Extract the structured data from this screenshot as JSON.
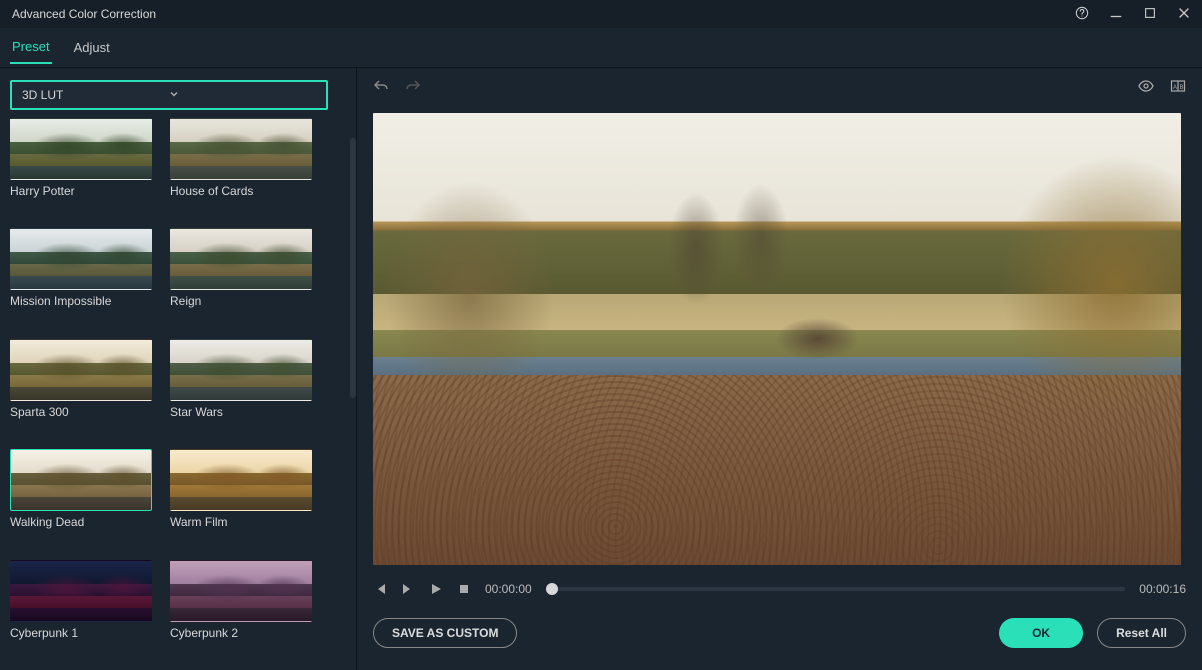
{
  "window": {
    "title": "Advanced Color Correction"
  },
  "tabs": {
    "preset": "Preset",
    "adjust": "Adjust",
    "active": "preset"
  },
  "dropdown": {
    "label": "3D LUT"
  },
  "presets": [
    {
      "label": "Harry Potter",
      "sky1": "#e8ede8",
      "sky2": "#d0d6c8",
      "tree1": "#4a6040",
      "tree2": "#3a5030",
      "bank1": "#6a6a40",
      "bank2": "#5a5a30",
      "water1": "#3a4a48",
      "water2": "#283830",
      "bush": "rgba(50,70,40,.8)"
    },
    {
      "label": "House of Cards",
      "sky1": "#e8e6de",
      "sky2": "#d6d0c0",
      "tree1": "#5a6a48",
      "tree2": "#4a5838",
      "bank1": "#7a6e4a",
      "bank2": "#6a5e3a",
      "water1": "#485048",
      "water2": "#383e38",
      "bush": "rgba(70,80,50,.8)"
    },
    {
      "label": "Mission Impossible",
      "sky1": "#e6eaec",
      "sky2": "#cad4d6",
      "tree1": "#405a48",
      "tree2": "#304838",
      "bank1": "#6a6a4a",
      "bank2": "#585838",
      "water1": "#384a50",
      "water2": "#283840",
      "bush": "rgba(50,70,50,.8)"
    },
    {
      "label": "Reign",
      "sky1": "#ece8e0",
      "sky2": "#d6d0c4",
      "tree1": "#4a6048",
      "tree2": "#3a5038",
      "bank1": "#7a6e4a",
      "bank2": "#6a5e3a",
      "water1": "#405048",
      "water2": "#303e38",
      "bush": "rgba(60,75,45,.8)"
    },
    {
      "label": "Sparta 300",
      "sky1": "#f2ecdc",
      "sky2": "#e0d4ba",
      "tree1": "#6a6a40",
      "tree2": "#585830",
      "bank1": "#8a7a4a",
      "bank2": "#786838",
      "water1": "#4a4838",
      "water2": "#383628",
      "bush": "rgba(90,80,40,.8)"
    },
    {
      "label": "Star Wars",
      "sky1": "#eeece6",
      "sky2": "#d8d4ca",
      "tree1": "#506048",
      "tree2": "#405038",
      "bank1": "#786e4a",
      "bank2": "#685e3a",
      "water1": "#404a48",
      "water2": "#303a38",
      "bush": "rgba(65,78,48,.8)"
    },
    {
      "label": "Walking Dead",
      "sky1": "#f6f2e8",
      "sky2": "#e4dccc",
      "tree1": "#6a6040",
      "tree2": "#585030",
      "bank1": "#8a7650",
      "bank2": "#786440",
      "water1": "#4a463a",
      "water2": "#38342a",
      "bush": "rgba(95,80,45,.8)",
      "selected": true
    },
    {
      "label": "Warm Film",
      "sky1": "#f8eacc",
      "sky2": "#ecd6a8",
      "tree1": "#8a6a30",
      "tree2": "#785828",
      "bank1": "#a07838",
      "bank2": "#8a662e",
      "water1": "#5a4a30",
      "water2": "#483a24",
      "bush": "rgba(130,90,40,.85)"
    },
    {
      "label": "Cyberpunk 1",
      "sky1": "#1a2448",
      "sky2": "#101830",
      "tree1": "#3a1a40",
      "tree2": "#2a1030",
      "bank1": "#5a1838",
      "bank2": "#481028",
      "water1": "#281030",
      "water2": "#180820",
      "bush": "rgba(80,20,60,.8)"
    },
    {
      "label": "Cyberpunk 2",
      "sky1": "#c0a0b8",
      "sky2": "#a080a0",
      "tree1": "#503850",
      "tree2": "#402840",
      "bank1": "#684058",
      "bank2": "#583048",
      "water1": "#382838",
      "water2": "#281828",
      "bush": "rgba(80,50,80,.8)"
    }
  ],
  "playback": {
    "current": "00:00:00",
    "total": "00:00:16"
  },
  "footer": {
    "save_custom": "SAVE AS CUSTOM",
    "ok": "OK",
    "reset": "Reset All"
  }
}
